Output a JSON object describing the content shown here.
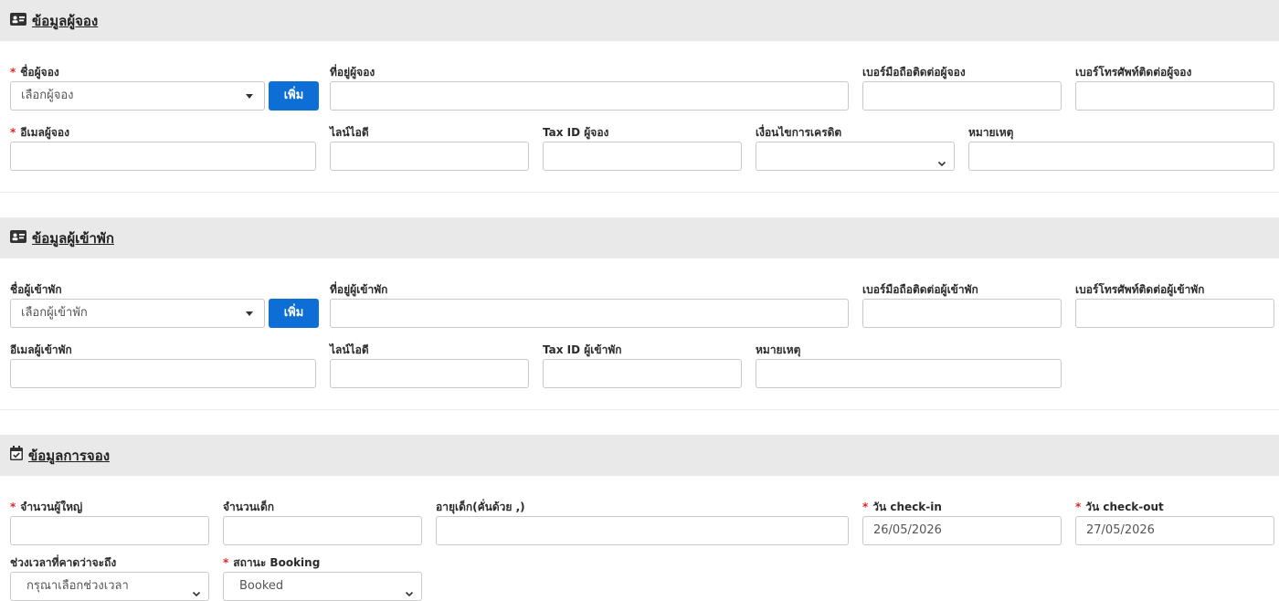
{
  "booker_section": {
    "title": "ข้อมูลผู้จอง",
    "name_label": "ชื่อผู้จอง",
    "name_select": "เลือกผู้จอง",
    "add_button": "เพิ่ม",
    "address_label": "ที่อยู่ผู้จอง",
    "mobile_label": "เบอร์มือถือติดต่อผู้จอง",
    "phone_label": "เบอร์โทรศัพท์ติดต่อผู้จอง",
    "email_label": "อีเมลผู้จอง",
    "line_label": "ไลน์ไอดี",
    "taxid_label": "Tax ID ผู้จอง",
    "credit_label": "เงื่อนไขการเครดิต",
    "note_label": "หมายเหตุ"
  },
  "guest_section": {
    "title": "ข้อมูลผู้เข้าพัก",
    "name_label": "ชื่อผู้เข้าพัก",
    "name_select": "เลือกผู้เข้าพัก",
    "add_button": "เพิ่ม",
    "address_label": "ที่อยู่ผู้เข้าพัก",
    "mobile_label": "เบอร์มือถือติดต่อผู้เข้าพัก",
    "phone_label": "เบอร์โทรศัพท์ติดต่อผู้เข้าพัก",
    "email_label": "อีเมลผู้เข้าพัก",
    "line_label": "ไลน์ไอดี",
    "taxid_label": "Tax ID ผู้เข้าพัก",
    "note_label": "หมายเหตุ"
  },
  "booking_section": {
    "title": "ข้อมูลการจอง",
    "adults_label": "จำนวนผู้ใหญ่",
    "children_label": "จำนวนเด็ก",
    "child_age_label": "อายุเด็ก(คั่นด้วย ,)",
    "checkin_label": "วัน check-in",
    "checkin_value": "26/05/2026",
    "checkout_label": "วัน check-out",
    "checkout_value": "27/05/2026",
    "arrival_label": "ช่วงเวลาที่คาดว่าจะถึง",
    "arrival_value": "กรุณาเลือกช่วงเวลา",
    "status_label": "สถานะ Booking",
    "status_value": "Booked"
  },
  "required_mark": "*"
}
